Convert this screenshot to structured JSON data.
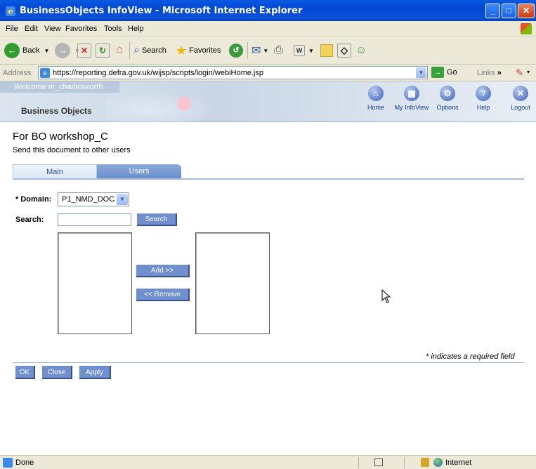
{
  "window": {
    "title": "BusinessObjects InfoView - Microsoft Internet Explorer"
  },
  "menu": [
    "File",
    "Edit",
    "View",
    "Favorites",
    "Tools",
    "Help"
  ],
  "toolbar": {
    "back": "Back",
    "search": "Search",
    "favorites": "Favorites"
  },
  "address": {
    "label": "Address",
    "url": "https://reporting.defra.gov.uk/wijsp/scripts/login/webiHome.jsp",
    "go": "Go",
    "links": "Links"
  },
  "bo": {
    "welcome": "Welcome m_charlesworth",
    "logo": "Business Objects",
    "nav": [
      "Home",
      "My InfoView",
      "Options",
      "Help",
      "Logout"
    ]
  },
  "page": {
    "title": "For BO workshop_C",
    "subtitle": "Send this document to other users"
  },
  "tabs": [
    "Main",
    "Users"
  ],
  "form": {
    "domain_label": "* Domain:",
    "domain_value": "P1_NMD_DOC",
    "search_label": "Search:",
    "search_value": "",
    "search_button": "Search",
    "add_button": "Add >>",
    "remove_button": "<< Remove",
    "required_note": "* indicates a required field"
  },
  "actions": {
    "ok": "OK",
    "close": "Close",
    "apply": "Apply"
  },
  "status": {
    "text": "Done",
    "zone": "Internet"
  }
}
